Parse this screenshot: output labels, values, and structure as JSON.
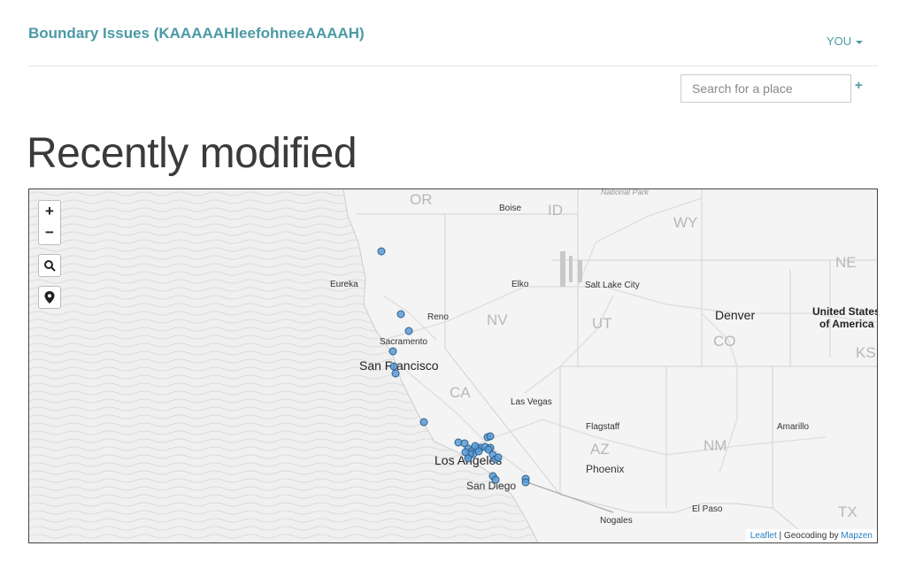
{
  "header": {
    "brand": "Boundary Issues (KAAAAAHleefohneeAAAAH)",
    "user_menu": "YOU"
  },
  "search": {
    "placeholder": "Search for a place",
    "add_label": "+"
  },
  "page": {
    "title": "Recently modified"
  },
  "map": {
    "controls": {
      "zoom_in": "+",
      "zoom_out": "−",
      "search_icon": "search-icon",
      "locate_icon": "map-pin-icon"
    },
    "labels": {
      "san_francisco": "San Francisco",
      "los_angeles": "Los Angeles",
      "denver": "Denver",
      "united_states_1": "United States",
      "united_states_2": "of America",
      "sacramento": "Sacramento",
      "reno": "Reno",
      "eureka": "Eureka",
      "boise": "Boise",
      "elko": "Elko",
      "salt_lake_city": "Salt Lake City",
      "las_vegas": "Las Vegas",
      "flagstaff": "Flagstaff",
      "phoenix": "Phoenix",
      "san_diego": "San Diego",
      "el_paso": "El Paso",
      "nogales": "Nogales",
      "amarillo": "Amarillo",
      "national_park": "National Park",
      "or": "OR",
      "id": "ID",
      "wy": "WY",
      "ne": "NE",
      "nv": "NV",
      "ut": "UT",
      "co": "CO",
      "ks": "KS",
      "ca": "CA",
      "az": "AZ",
      "nm": "NM",
      "tx": "TX"
    },
    "attribution": {
      "leaflet": "Leaflet",
      "separator": " | Geocoding by ",
      "mapzen": "Mapzen"
    },
    "marker_color": "#5b9bd5",
    "marker_stroke": "#2c5f8a",
    "marker_count": 32
  }
}
